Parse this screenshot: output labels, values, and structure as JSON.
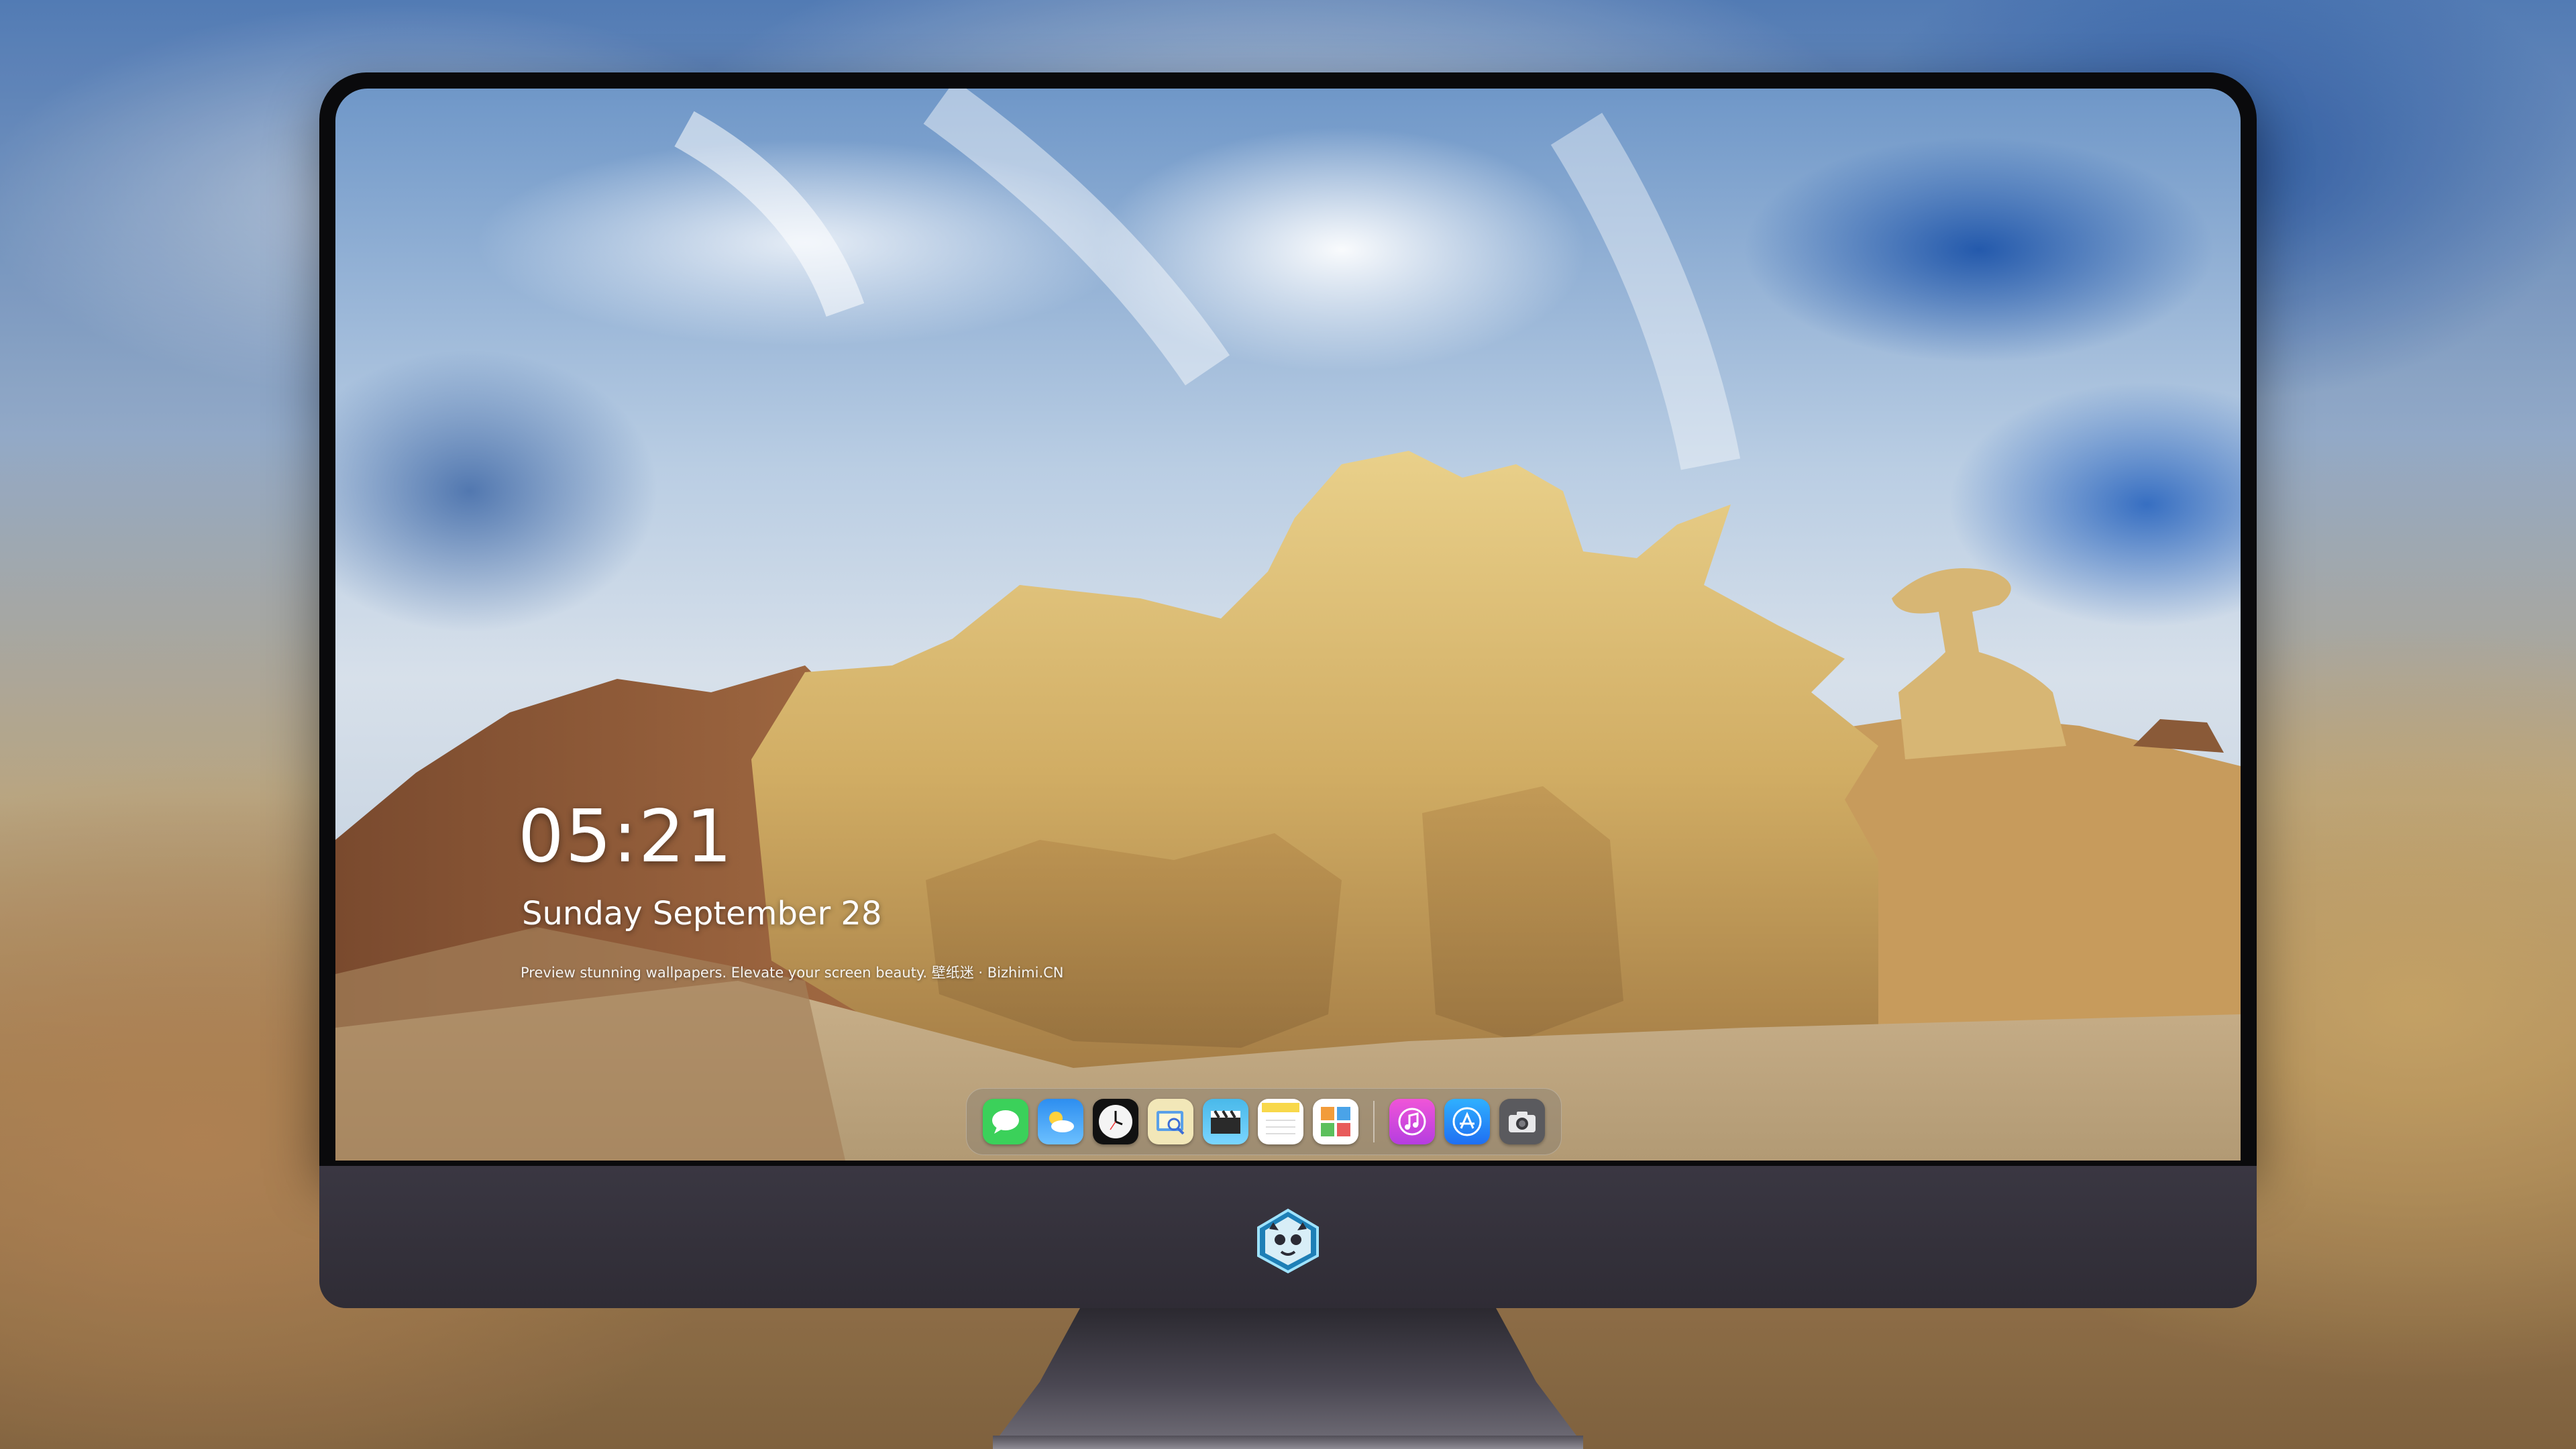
{
  "lockscreen": {
    "time": "05:21",
    "date": "Sunday September  28",
    "caption": "Preview stunning wallpapers. Elevate your screen beauty.  壁纸迷 · Bizhimi.CN"
  },
  "dock": {
    "apps": [
      {
        "name": "messages-icon",
        "color": "#3bd15a"
      },
      {
        "name": "weather-icon",
        "color": "#2d8ef0"
      },
      {
        "name": "clock-icon",
        "color": "#f4f4f4"
      },
      {
        "name": "preview-icon",
        "color": "#f2e7b8"
      },
      {
        "name": "video-clips-icon",
        "color": "#49b9ea"
      },
      {
        "name": "notes-icon",
        "color": "#f8d84a"
      },
      {
        "name": "photo-grid-icon",
        "color": "#ffffff"
      },
      {
        "name": "music-icon",
        "color": "#d942c9"
      },
      {
        "name": "app-store-icon",
        "color": "#1f8ff2"
      },
      {
        "name": "camera-icon",
        "color": "#5a5a5e"
      }
    ]
  },
  "chin": {
    "logo": "mascot-logo-icon"
  }
}
